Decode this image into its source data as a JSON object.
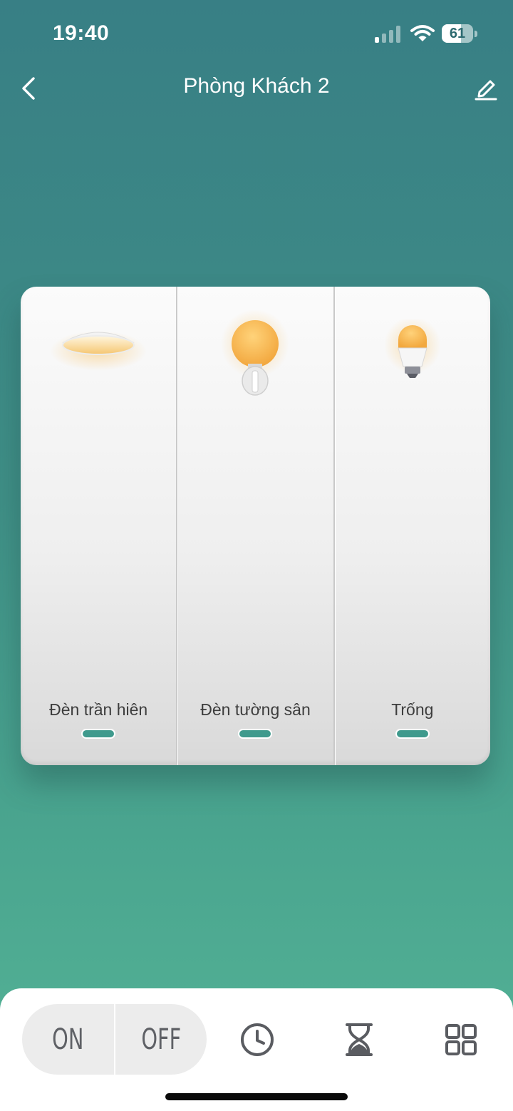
{
  "status_bar": {
    "time": "19:40",
    "battery_level": "61",
    "battery_fraction": 0.61,
    "signal_bars_active": 1,
    "signal_bars_total": 4,
    "icons": [
      "cellular-signal-icon",
      "wifi-icon",
      "battery-icon"
    ]
  },
  "nav": {
    "title": "Phòng Khách 2",
    "back_icon": "chevron-left-icon",
    "edit_icon": "pencil-icon"
  },
  "switch_panel": {
    "gangs": [
      {
        "label": "Đèn trần hiên",
        "icon": "ceiling-light-icon",
        "state": "on"
      },
      {
        "label": "Đèn tường sân",
        "icon": "wall-lamp-icon",
        "state": "on"
      },
      {
        "label": "Trống",
        "icon": "light-bulb-icon",
        "state": "on"
      }
    ],
    "indicator_color": "#3f9a8d",
    "light_color": "#f7b54a"
  },
  "bottom_bar": {
    "on_label": "ON",
    "off_label": "OFF",
    "schedule_icon": "clock-icon",
    "timer_icon": "hourglass-icon",
    "more_icon": "grid-icon"
  },
  "colors": {
    "background_top": "#387f85",
    "background_bottom": "#54b396",
    "accent": "#3f9a8d"
  }
}
